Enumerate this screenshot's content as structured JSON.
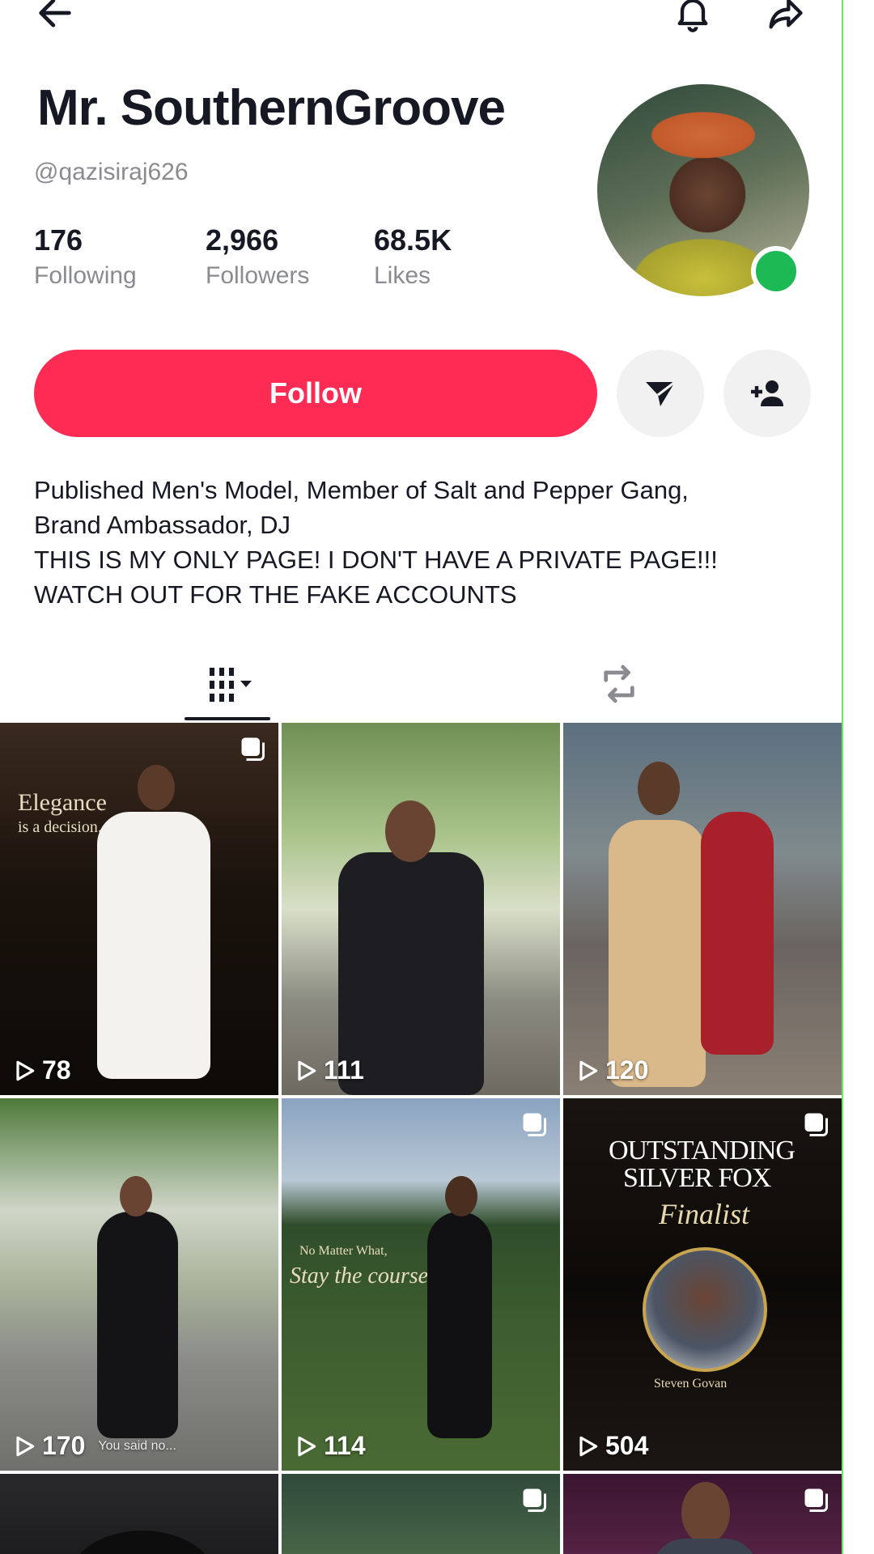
{
  "profile": {
    "name": "Mr. SouthernGroove",
    "handle": "@qazisiraj626",
    "stats": [
      {
        "value": "176",
        "label": "Following"
      },
      {
        "value": "2,966",
        "label": "Followers"
      },
      {
        "value": "68.5K",
        "label": "Likes"
      }
    ],
    "follow_label": "Follow",
    "bio": [
      "Published Men's Model, Member of Salt and Pepper Gang,",
      "Brand Ambassador, DJ",
      "THIS IS MY ONLY PAGE! I DON'T HAVE A PRIVATE PAGE!!!",
      "WATCH OUT FOR THE FAKE ACCOUNTS"
    ]
  },
  "icons": {
    "back": "back-arrow-icon",
    "notifications": "bell-icon",
    "share": "share-icon",
    "message": "send-message-icon",
    "suggested": "add-friend-icon",
    "videos_tab": "grid-icon",
    "reposts_tab": "repost-icon",
    "play": "play-icon",
    "multi": "multi-photo-icon"
  },
  "colors": {
    "accent": "#fe2c55",
    "online": "#1db954"
  },
  "posts": [
    {
      "views": "78",
      "overlay": [
        "Elegance",
        "is a decision."
      ]
    },
    {
      "views": "111"
    },
    {
      "views": "120"
    },
    {
      "views": "170",
      "caption": "You said no..."
    },
    {
      "views": "114",
      "overlay": [
        "No Matter What,",
        "Stay the course"
      ]
    },
    {
      "views": "504",
      "overlay": [
        "OUTSTANDING",
        "SILVER FOX",
        "Finalist",
        "Steven Govan"
      ]
    },
    {},
    {},
    {}
  ]
}
